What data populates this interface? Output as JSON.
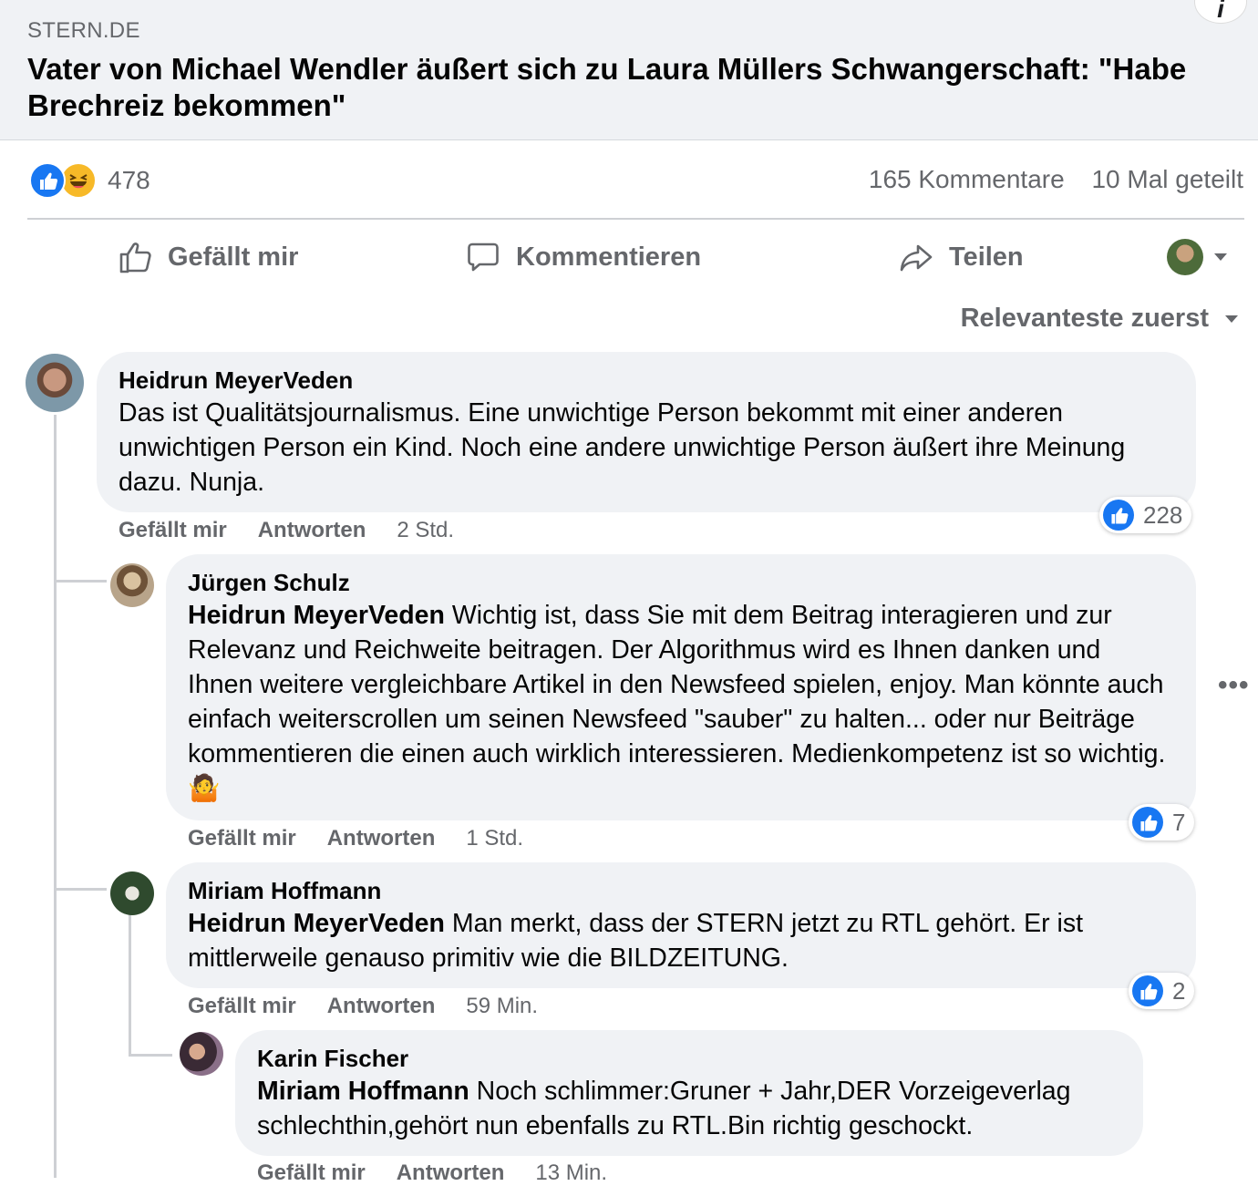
{
  "link": {
    "domain": "STERN.DE",
    "title": "Vater von Michael Wendler äußert sich zu Laura Müllers Schwangerschaft: \"Habe Brechreiz bekommen\""
  },
  "stats": {
    "reaction_count": "478",
    "comments": "165 Kommentare",
    "shares": "10 Mal geteilt"
  },
  "actions": {
    "like": "Gefällt mir",
    "comment": "Kommentieren",
    "share": "Teilen"
  },
  "sort": {
    "label": "Relevanteste zuerst"
  },
  "comments": [
    {
      "author": "Heidrun MeyerVeden",
      "mention": "",
      "text": "Das ist Qualitätsjournalismus. Eine unwichtige Person bekommt mit einer anderen unwichtigen Person ein Kind. Noch eine andere unwichtige Person äußert ihre Meinung dazu. Nunja.",
      "like": "Gefällt mir",
      "reply": "Antworten",
      "time": "2 Std.",
      "reactions": "228"
    },
    {
      "author": "Jürgen Schulz",
      "mention": "Heidrun MeyerVeden",
      "text": " Wichtig ist, dass Sie mit dem Beitrag interagieren und zur Relevanz und Reichweite beitragen. Der Algorithmus wird es Ihnen danken und Ihnen weitere vergleichbare Artikel in den Newsfeed spielen, enjoy. Man könnte auch einfach weiterscrollen um seinen Newsfeed \"sauber\" zu halten... oder nur Beiträge kommentieren die einen auch wirklich interessieren. Medienkompetenz ist so wichtig.🤷",
      "like": "Gefällt mir",
      "reply": "Antworten",
      "time": "1 Std.",
      "reactions": "7"
    },
    {
      "author": "Miriam Hoffmann",
      "mention": "Heidrun MeyerVeden",
      "text": " Man merkt, dass der STERN jetzt zu RTL gehört. Er ist mittlerweile genauso primitiv wie die BILDZEITUNG.",
      "like": "Gefällt mir",
      "reply": "Antworten",
      "time": "59 Min.",
      "reactions": "2"
    },
    {
      "author": "Karin Fischer",
      "mention": "Miriam Hoffmann",
      "text": " Noch schlimmer:Gruner + Jahr,DER Vorzeigeverlag schlechthin,gehört nun ebenfalls zu RTL.Bin richtig geschockt.",
      "like": "Gefällt mir",
      "reply": "Antworten",
      "time": "13 Min."
    }
  ],
  "more_options": "•••"
}
